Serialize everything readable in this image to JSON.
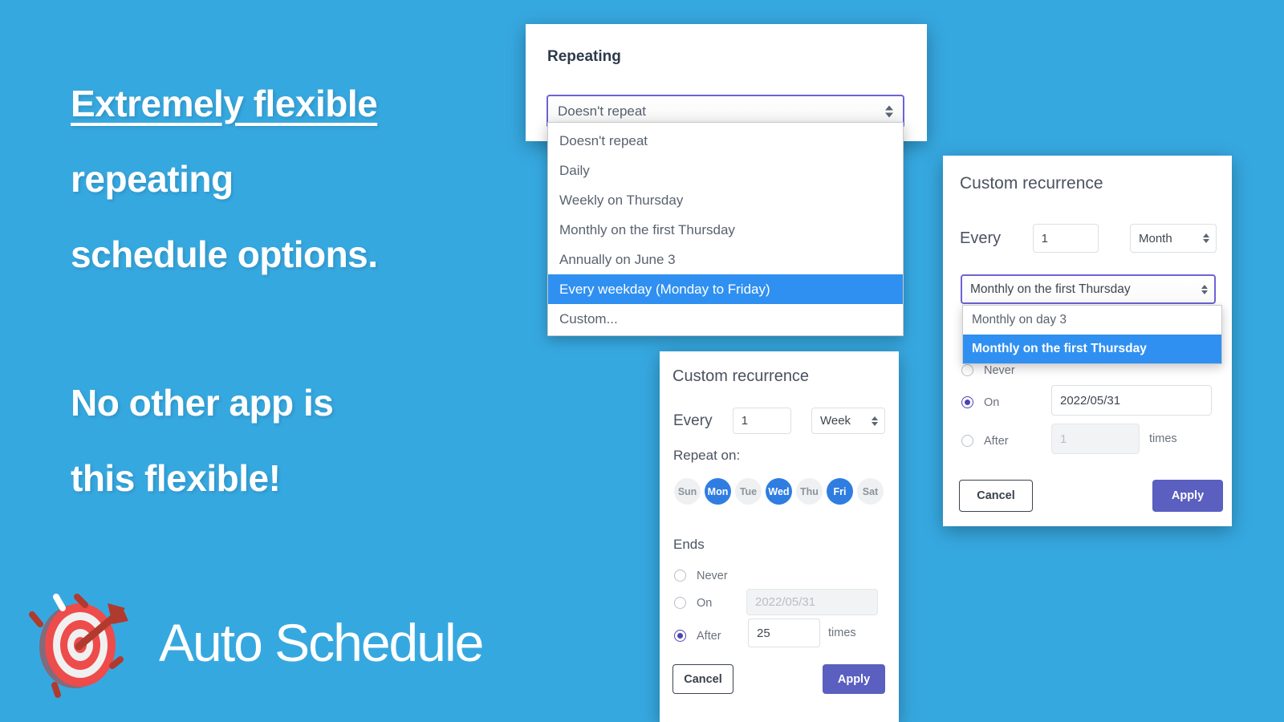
{
  "theme": {
    "background": "#36a8e0",
    "accent_blue": "#2f7de1",
    "highlight_blue": "#2f90f2",
    "apply_purple": "#5a5fc0",
    "focus_purple": "#6c63d8"
  },
  "promo": {
    "line1": "Extremely flexible",
    "line2": "repeating",
    "line3": "schedule options.",
    "line4": "No other app is",
    "line5": "this flexible!"
  },
  "brand": {
    "name": "Auto Schedule",
    "icon": "target-arrow-icon"
  },
  "repeating_card": {
    "title": "Repeating",
    "select_value": "Doesn't repeat",
    "options": [
      {
        "label": "Doesn't repeat",
        "selected": false
      },
      {
        "label": "Daily",
        "selected": false
      },
      {
        "label": "Weekly on Thursday",
        "selected": false
      },
      {
        "label": "Monthly on the first Thursday",
        "selected": false
      },
      {
        "label": "Annually on June 3",
        "selected": false
      },
      {
        "label": "Every weekday (Monday to Friday)",
        "selected": true
      },
      {
        "label": "Custom...",
        "selected": false
      }
    ]
  },
  "custom_weekly": {
    "title": "Custom recurrence",
    "every_label": "Every",
    "interval_value": "1",
    "unit_value": "Week",
    "repeat_on_label": "Repeat on:",
    "days": [
      {
        "label": "Sun",
        "selected": false
      },
      {
        "label": "Mon",
        "selected": true
      },
      {
        "label": "Tue",
        "selected": false
      },
      {
        "label": "Wed",
        "selected": true
      },
      {
        "label": "Thu",
        "selected": false
      },
      {
        "label": "Fri",
        "selected": true
      },
      {
        "label": "Sat",
        "selected": false
      }
    ],
    "ends_label": "Ends",
    "never_label": "Never",
    "on_label": "On",
    "on_date_placeholder": "2022/05/31",
    "on_date_value": "",
    "after_label": "After",
    "after_value": "25",
    "times_label": "times",
    "selected_end": "After",
    "cancel_label": "Cancel",
    "apply_label": "Apply"
  },
  "custom_monthly": {
    "title": "Custom recurrence",
    "every_label": "Every",
    "interval_value": "1",
    "unit_value": "Month",
    "mode_value": "Monthly on the first Thursday",
    "mode_options": [
      {
        "label": "Monthly on day 3",
        "selected": false
      },
      {
        "label": "Monthly on the first Thursday",
        "selected": true
      }
    ],
    "never_label": "Never",
    "on_label": "On",
    "on_date_value": "2022/05/31",
    "after_label": "After",
    "after_placeholder": "1",
    "times_label": "times",
    "selected_end": "On",
    "cancel_label": "Cancel",
    "apply_label": "Apply"
  }
}
